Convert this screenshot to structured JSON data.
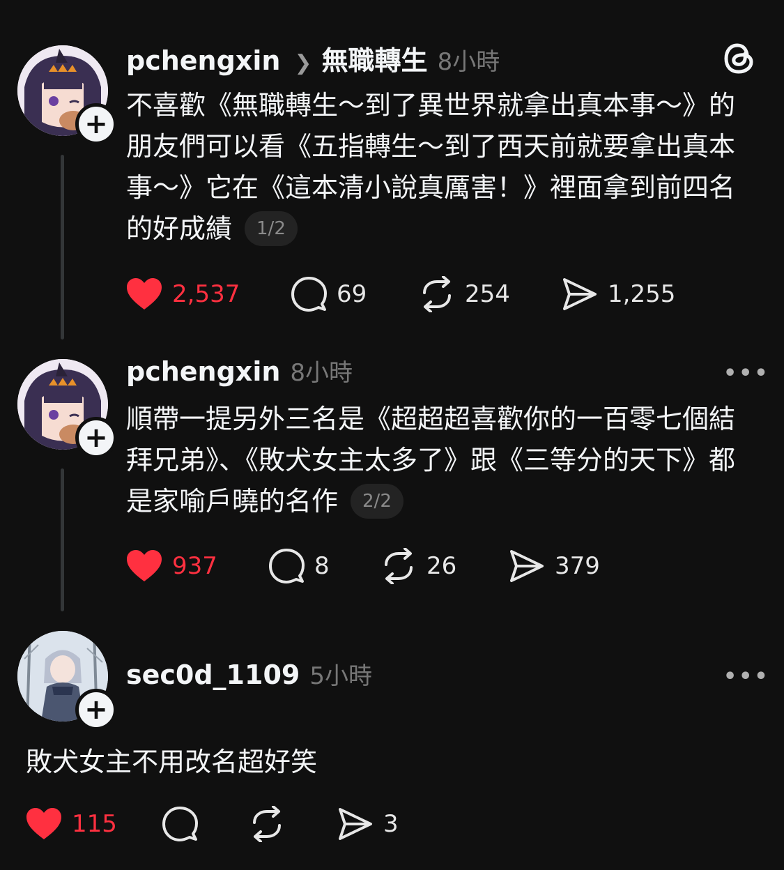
{
  "posts": [
    {
      "username": "pchengxin",
      "topic": "無職轉生",
      "time": "8小時",
      "text": "不喜歡《無職轉生～到了異世界就拿出真本事～》的朋友們可以看《五指轉生～到了西天前就要拿出真本事～》它在《這本清小說真厲害！》裡面拿到前四名的好成績",
      "page_indicator": "1/2",
      "likes": "2,537",
      "comments": "69",
      "reposts": "254",
      "shares": "1,255",
      "liked": true
    },
    {
      "username": "pchengxin",
      "time": "8小時",
      "text": "順帶一提另外三名是《超超超喜歡你的一百零七個結拜兄弟》、《敗犬女主太多了》跟《三等分的天下》都是家喻戶曉的名作",
      "page_indicator": "2/2",
      "likes": "937",
      "comments": "8",
      "reposts": "26",
      "shares": "379",
      "liked": true
    },
    {
      "username": "sec0d_1109",
      "time": "5小時",
      "text": "敗犬女主不用改名超好笑",
      "likes": "115",
      "shares": "3",
      "liked": true
    }
  ],
  "icons": {
    "app_logo": "threads-logo-icon",
    "follow": "plus-icon",
    "like": "heart-icon",
    "comment": "comment-bubble-icon",
    "repost": "repost-icon",
    "share": "send-icon",
    "more": "more-horizontal-icon",
    "chevron": "chevron-right-icon"
  },
  "colors": {
    "background": "#101010",
    "text": "#f3f5f7",
    "secondary": "#777777",
    "like_red": "#ff3040"
  }
}
